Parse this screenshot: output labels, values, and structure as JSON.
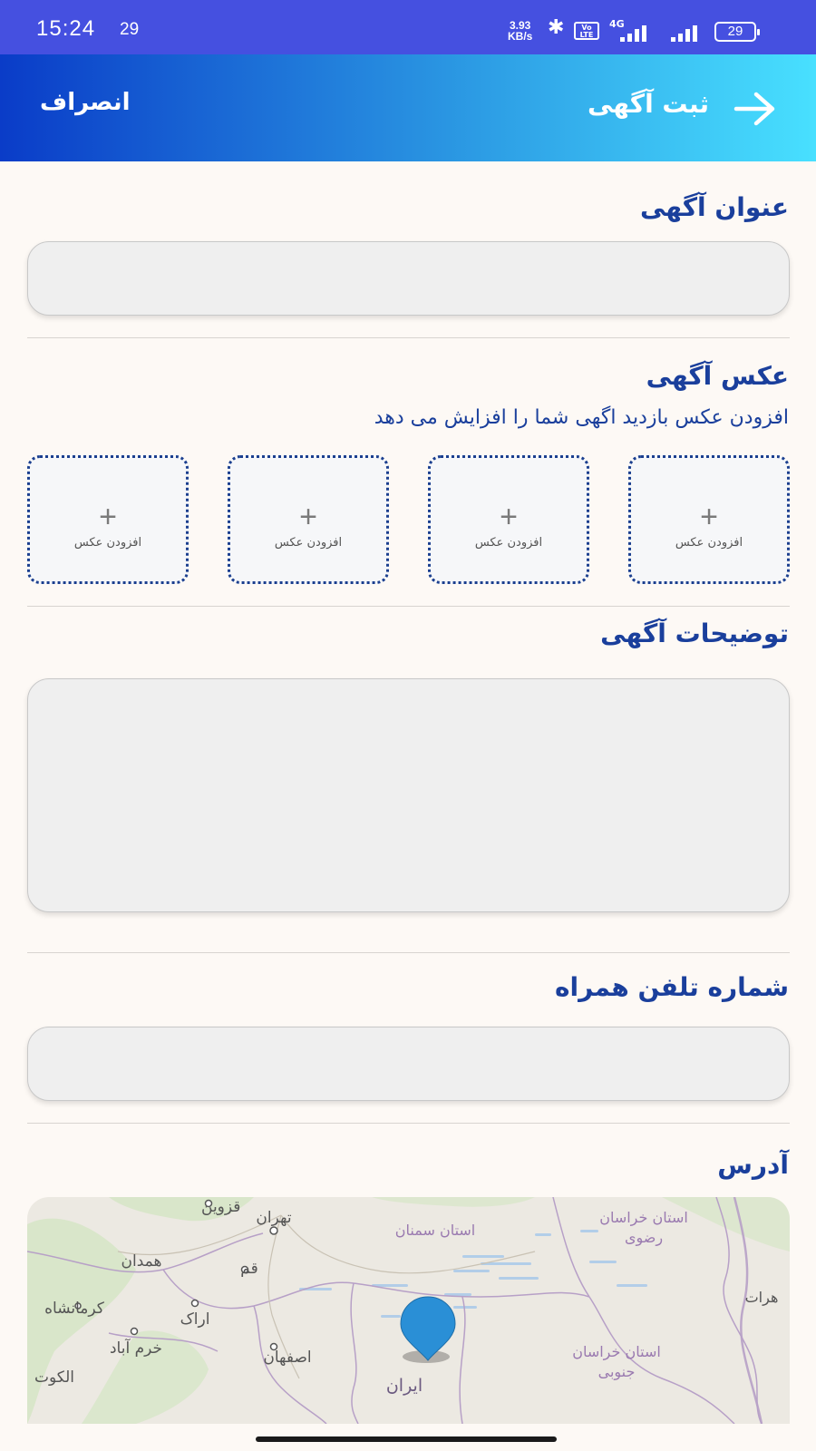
{
  "status_bar": {
    "time": "15:24",
    "notification": "29",
    "speed_value": "3.93",
    "speed_unit": "KB/s",
    "volte": "Vo LTE",
    "network": "4G",
    "battery": "29"
  },
  "header": {
    "title": "ثبت آگهی",
    "cancel": "انصراف"
  },
  "form": {
    "title_label": "عنوان آگهی",
    "title_value": "",
    "photo_label": "عکس آگهی",
    "photo_hint": "افزودن عکس بازدید اگهی شما را افزایش می دهد",
    "photo_slots": [
      {
        "plus": "+",
        "caption": "افزودن عکس"
      },
      {
        "plus": "+",
        "caption": "افزودن عکس"
      },
      {
        "plus": "+",
        "caption": "افزودن عکس"
      },
      {
        "plus": "+",
        "caption": "افزودن عکس"
      }
    ],
    "description_label": "توضیحات آگهی",
    "description_value": "",
    "phone_label": "شماره تلفن همراه",
    "phone_value": "",
    "address_label": "آدرس"
  },
  "map": {
    "places": {
      "qazvin": "قزوین",
      "tehran": "تهران",
      "semnan": "استان سمنان",
      "khorasan_razavi_1": "استان خراسان",
      "khorasan_razavi_2": "رضوی",
      "hamedan": "همدان",
      "qom": "قم",
      "kermanshah": "کرمانشاه",
      "arak": "اراک",
      "herat": "هرات",
      "khorramabad": "خرم آباد",
      "isfahan": "اصفهان",
      "khorasan_south_1": "استان خراسان",
      "khorasan_south_2": "جنوبی",
      "kuwait": "الکوت",
      "iran": "ایران"
    },
    "colors": {
      "land": "#ece9e2",
      "green": "#d7e6c8",
      "water": "#a9c9ea",
      "border": "#b7a0c7",
      "pin": "#2a8fd6"
    }
  }
}
